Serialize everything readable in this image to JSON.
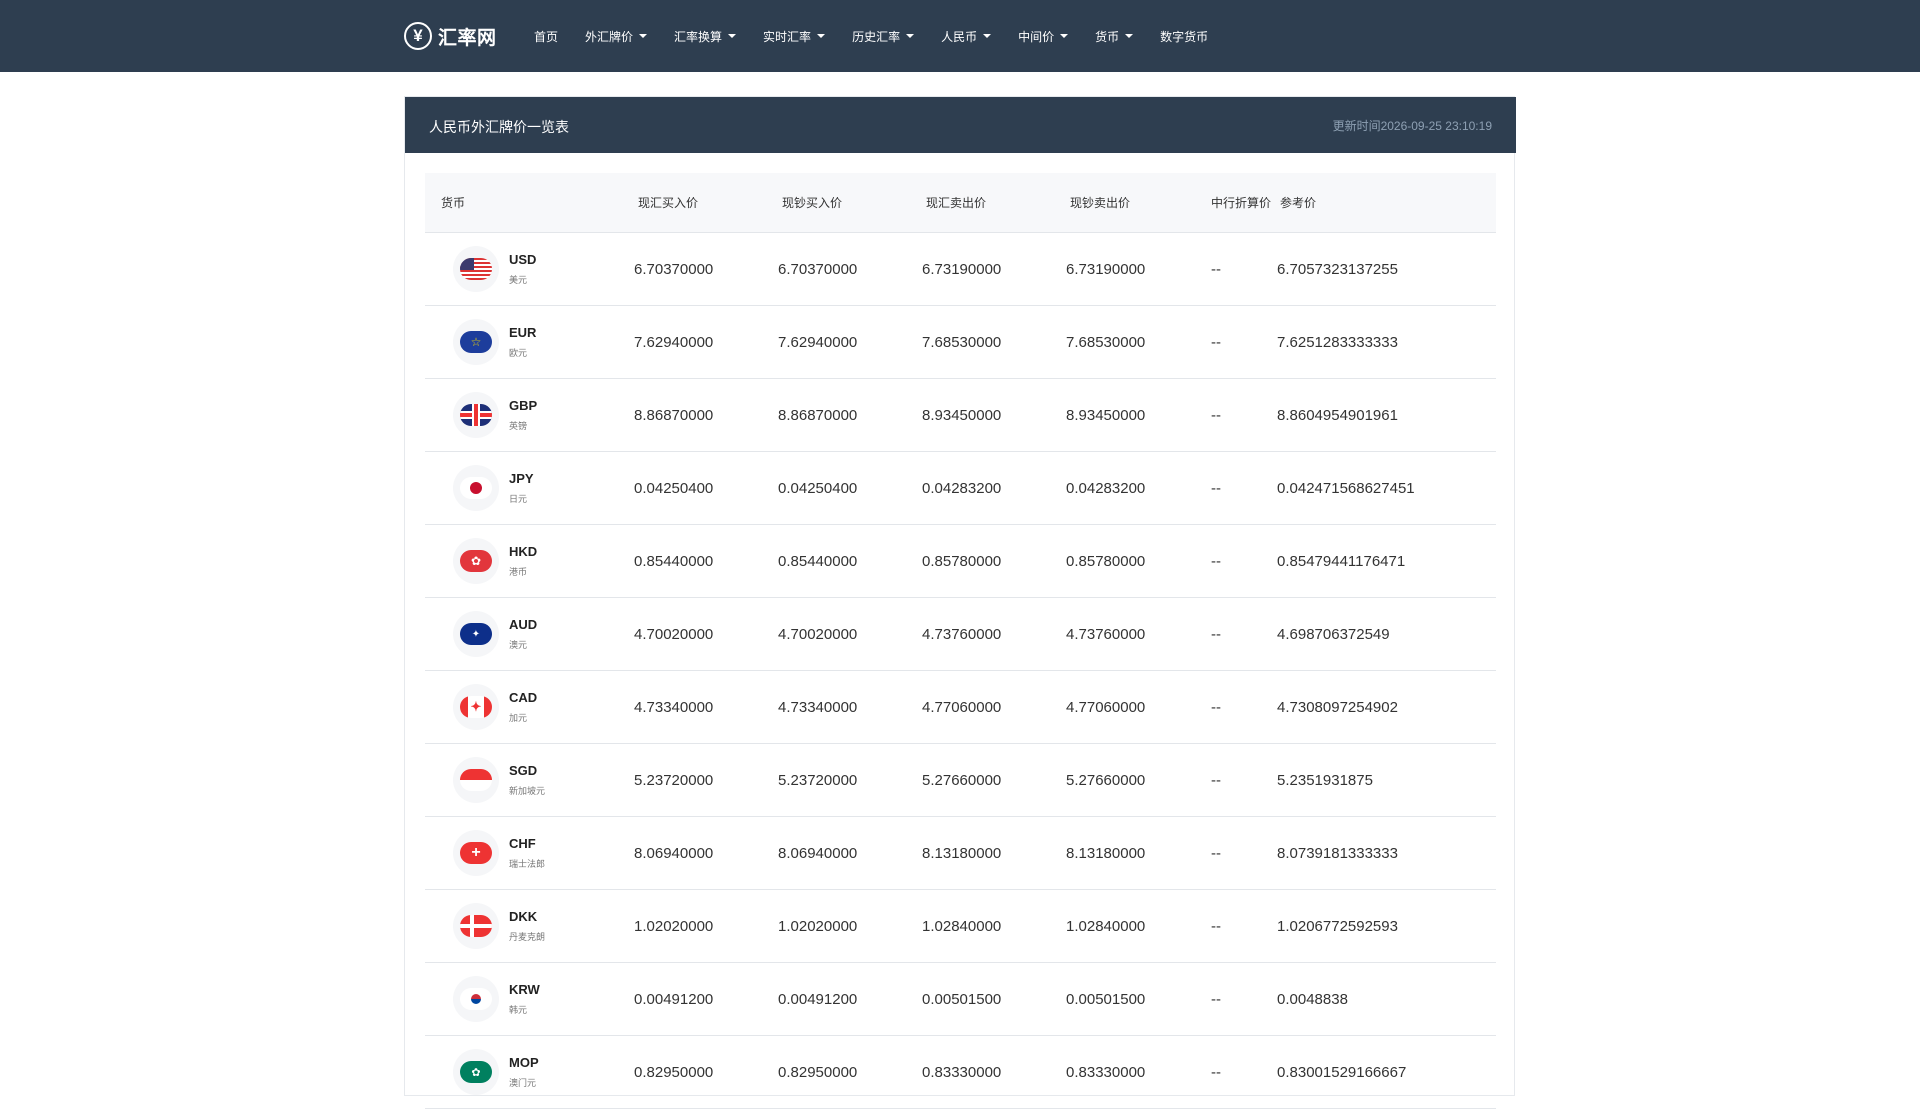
{
  "nav": {
    "logo_text": "汇率网",
    "items": [
      {
        "label": "首页",
        "dropdown": false
      },
      {
        "label": "外汇牌价",
        "dropdown": true
      },
      {
        "label": "汇率换算",
        "dropdown": true
      },
      {
        "label": "实时汇率",
        "dropdown": true
      },
      {
        "label": "历史汇率",
        "dropdown": true
      },
      {
        "label": "人民币",
        "dropdown": true
      },
      {
        "label": "中间价",
        "dropdown": true
      },
      {
        "label": "货币",
        "dropdown": true
      },
      {
        "label": "数字货币",
        "dropdown": false
      }
    ]
  },
  "panel": {
    "title": "人民币外汇牌价一览表",
    "update_time": "更新时间2026-09-25 23:10:19"
  },
  "table": {
    "headers": [
      "货币",
      "现汇买入价",
      "现钞买入价",
      "现汇卖出价",
      "现钞卖出价",
      "中行折算价",
      "参考价"
    ],
    "rows": [
      {
        "code": "USD",
        "name": "美元",
        "flag": "us-flag-icon",
        "v1": "6.70370000",
        "v2": "6.70370000",
        "v3": "6.73190000",
        "v4": "6.73190000",
        "v5": "--",
        "v6": "6.7057323137255"
      },
      {
        "code": "EUR",
        "name": "欧元",
        "flag": "eu-flag-icon",
        "v1": "7.62940000",
        "v2": "7.62940000",
        "v3": "7.68530000",
        "v4": "7.68530000",
        "v5": "--",
        "v6": "7.6251283333333"
      },
      {
        "code": "GBP",
        "name": "英镑",
        "flag": "uk-flag-icon",
        "v1": "8.86870000",
        "v2": "8.86870000",
        "v3": "8.93450000",
        "v4": "8.93450000",
        "v5": "--",
        "v6": "8.8604954901961"
      },
      {
        "code": "JPY",
        "name": "日元",
        "flag": "jp-flag-icon",
        "v1": "0.04250400",
        "v2": "0.04250400",
        "v3": "0.04283200",
        "v4": "0.04283200",
        "v5": "--",
        "v6": "0.042471568627451"
      },
      {
        "code": "HKD",
        "name": "港币",
        "flag": "hk-flag-icon",
        "v1": "0.85440000",
        "v2": "0.85440000",
        "v3": "0.85780000",
        "v4": "0.85780000",
        "v5": "--",
        "v6": "0.85479441176471"
      },
      {
        "code": "AUD",
        "name": "澳元",
        "flag": "au-flag-icon",
        "v1": "4.70020000",
        "v2": "4.70020000",
        "v3": "4.73760000",
        "v4": "4.73760000",
        "v5": "--",
        "v6": "4.698706372549"
      },
      {
        "code": "CAD",
        "name": "加元",
        "flag": "ca-flag-icon",
        "v1": "4.73340000",
        "v2": "4.73340000",
        "v3": "4.77060000",
        "v4": "4.77060000",
        "v5": "--",
        "v6": "4.7308097254902"
      },
      {
        "code": "SGD",
        "name": "新加坡元",
        "flag": "sg-flag-icon",
        "v1": "5.23720000",
        "v2": "5.23720000",
        "v3": "5.27660000",
        "v4": "5.27660000",
        "v5": "--",
        "v6": "5.2351931875"
      },
      {
        "code": "CHF",
        "name": "瑞士法郎",
        "flag": "ch-flag-icon",
        "v1": "8.06940000",
        "v2": "8.06940000",
        "v3": "8.13180000",
        "v4": "8.13180000",
        "v5": "--",
        "v6": "8.0739181333333"
      },
      {
        "code": "DKK",
        "name": "丹麦克朗",
        "flag": "dk-flag-icon",
        "v1": "1.02020000",
        "v2": "1.02020000",
        "v3": "1.02840000",
        "v4": "1.02840000",
        "v5": "--",
        "v6": "1.0206772592593"
      },
      {
        "code": "KRW",
        "name": "韩元",
        "flag": "kr-flag-icon",
        "v1": "0.00491200",
        "v2": "0.00491200",
        "v3": "0.00501500",
        "v4": "0.00501500",
        "v5": "--",
        "v6": "0.0048838"
      },
      {
        "code": "MOP",
        "name": "澳门元",
        "flag": "mo-flag-icon",
        "v1": "0.82950000",
        "v2": "0.82950000",
        "v3": "0.83330000",
        "v4": "0.83330000",
        "v5": "--",
        "v6": "0.83001529166667"
      }
    ]
  }
}
